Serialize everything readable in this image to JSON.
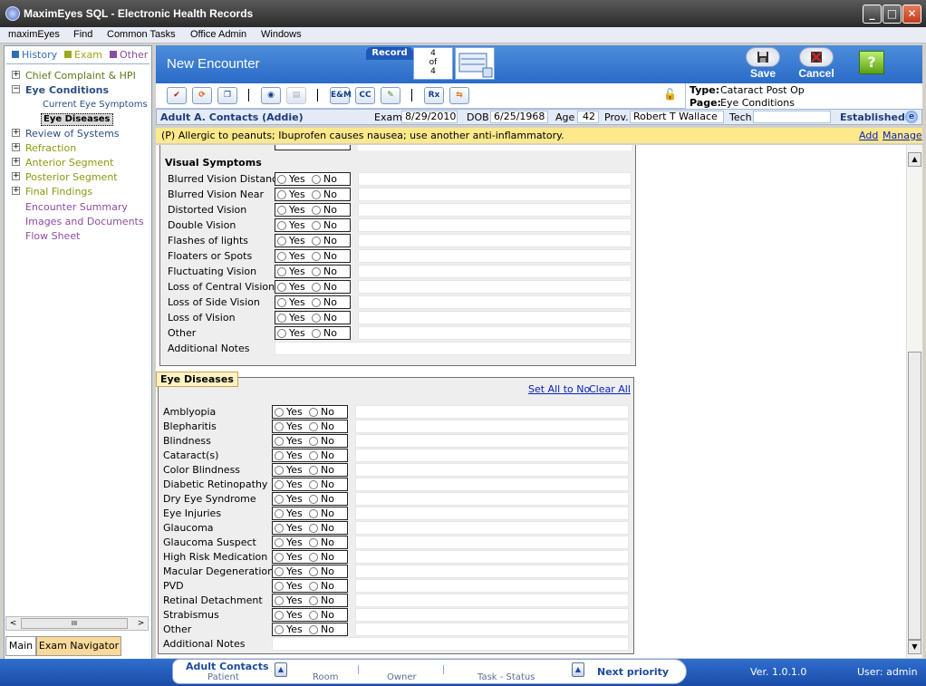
{
  "window": {
    "title": "MaximEyes SQL - Electronic Health Records",
    "controls": {
      "minimize": "_",
      "maximize": "□",
      "close": "✕"
    }
  },
  "menu": [
    "maximEyes",
    "Find",
    "Common Tasks",
    "Office Admin",
    "Windows"
  ],
  "navigator": {
    "legend": [
      {
        "label": "History",
        "color": "#2e6db8"
      },
      {
        "label": "Exam",
        "color": "#9aaa1a"
      },
      {
        "label": "Other",
        "color": "#8c4ca0"
      }
    ],
    "tree": [
      {
        "label": "Chief Complaint & HPI",
        "expander": "+"
      },
      {
        "label": "Eye Conditions",
        "expander": "−"
      },
      {
        "label": "Current Eye Symptoms"
      },
      {
        "label": "Eye Diseases"
      },
      {
        "label": "Review of Systems",
        "expander": "+"
      },
      {
        "label": "Refraction",
        "expander": "+"
      },
      {
        "label": "Anterior Segment",
        "expander": "+"
      },
      {
        "label": "Posterior Segment",
        "expander": "+"
      },
      {
        "label": "Final Findings",
        "expander": "+"
      },
      {
        "label": "Encounter Summary"
      },
      {
        "label": "Images and Documents"
      },
      {
        "label": "Flow Sheet"
      }
    ],
    "tabs": [
      "Main",
      "Exam Navigator"
    ],
    "scroll_left": "<",
    "scroll_right": ">",
    "scroll_grip": "III"
  },
  "header": {
    "title": "New Encounter",
    "record_label": "Record",
    "record_current": "4",
    "record_of": "of",
    "record_total": "4",
    "save_label": "Save",
    "cancel_label": "Cancel",
    "help_label": "?"
  },
  "toolbar": {
    "buttons": [
      {
        "name": "check-icon",
        "label": "✔"
      },
      {
        "name": "refresh-icon",
        "label": "⟳"
      },
      {
        "name": "copy-icon",
        "label": "❐"
      },
      {
        "name": "eye-icon",
        "label": "◉"
      },
      {
        "name": "document-icon",
        "label": "▤"
      },
      {
        "name": "em-button",
        "label": "E&M"
      },
      {
        "name": "cc-button",
        "label": "CC"
      },
      {
        "name": "pencil-icon",
        "label": "✎"
      },
      {
        "name": "rx-button",
        "label": "Rx"
      },
      {
        "name": "transfer-icon",
        "label": "⇆"
      }
    ],
    "lock_icon": "🔓"
  },
  "type_page": {
    "type_label": "Type:",
    "type_value": "Cataract Post Op",
    "page_label": "Page:",
    "page_value": "Eye Conditions"
  },
  "patient": {
    "name": "Adult A. Contacts (Addie)",
    "exam_label": "Exam",
    "exam": "8/29/2010",
    "dob_label": "DOB",
    "dob": "6/25/1968",
    "age_label": "Age",
    "age": "42",
    "prov_label": "Prov.",
    "prov": "Robert T Wallace",
    "tech_label": "Tech",
    "tech": "",
    "status": "Established"
  },
  "allergy": {
    "text": "(P) Allergic to peanuts; Ibuprofen causes nausea; use another anti-inflammatory.",
    "add": "Add",
    "manage": "Manage"
  },
  "visual_symptoms": {
    "title": "Visual Symptoms",
    "rows": [
      "Blurred Vision Distance",
      "Blurred Vision Near",
      "Distorted Vision",
      "Double Vision",
      "Flashes of lights",
      "Floaters or Spots",
      "Fluctuating Vision",
      "Loss of Central Vision",
      "Loss of Side Vision",
      "Loss of Vision",
      "Other"
    ],
    "notes_label": "Additional Notes"
  },
  "eye_diseases": {
    "title": "Eye Diseases",
    "set_all_no": "Set All to No",
    "clear_all": "Clear All",
    "rows": [
      "Amblyopia",
      "Blepharitis",
      "Blindness",
      "Cataract(s)",
      "Color Blindness",
      "Diabetic Retinopathy",
      "Dry Eye Syndrome",
      "Eye Injuries",
      "Glaucoma",
      "Glaucoma Suspect",
      "High Risk Medication",
      "Macular Degeneration",
      "PVD",
      "Retinal Detachment",
      "Strabismus",
      "Other"
    ],
    "notes_label": "Additional Notes"
  },
  "yes_label": "Yes",
  "no_label": "No",
  "status_bar": {
    "patient_name": "Adult Contacts",
    "patient_label": "Patient",
    "room_label": "Room",
    "owner_label": "Owner",
    "task_label": "Task - Status",
    "next_priority": "Next priority",
    "version": "Ver. 1.0.1.0",
    "user": "User: admin"
  }
}
